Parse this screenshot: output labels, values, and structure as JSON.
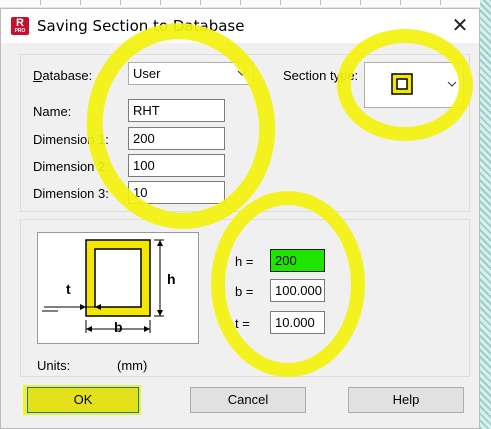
{
  "window": {
    "title": "Saving Section to Database",
    "app_icon": "R",
    "app_icon_sub": "PRO"
  },
  "form": {
    "database_label_ul": "D",
    "database_label_rest": "atabase:",
    "database_value": "User",
    "name_label": "Name:",
    "name_value": "RHT",
    "dim1_label": "Dimension 1:",
    "dim1_value": "200",
    "dim2_label": "Dimension 2:",
    "dim2_value": "100",
    "dim3_label": "Dimension 3:",
    "dim3_value": "10",
    "section_type_label_pre": "Section t",
    "section_type_label_ul": "y",
    "section_type_label_post": "pe:",
    "section_type_icon": "rectangular-hollow-tube-icon"
  },
  "diagram": {
    "t": "t",
    "h": "h",
    "b": "b"
  },
  "props": [
    {
      "label": "h =",
      "value": "200"
    },
    {
      "label": "b =",
      "value": "100.000"
    },
    {
      "label": "t =",
      "value": "10.000"
    }
  ],
  "units": {
    "label": "Units:",
    "value": "(mm)"
  },
  "buttons": {
    "ok": "OK",
    "cancel": "Cancel",
    "help": "Help"
  },
  "colors": {
    "highlight": "#f3f20c",
    "active_field": "#1ee600",
    "brand": "#c8102e"
  }
}
